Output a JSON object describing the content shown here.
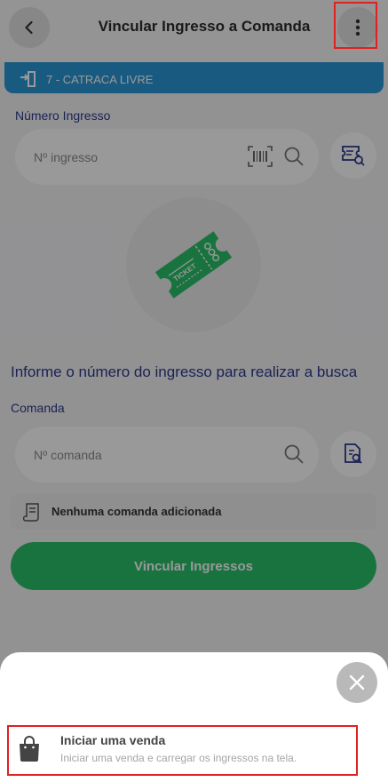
{
  "header": {
    "title": "Vincular Ingresso a Comanda",
    "back_icon": "chevron-left-icon",
    "menu_icon": "more-vertical-icon"
  },
  "gate": {
    "icon": "turnstile-exit-icon",
    "label": "7 - CATRACA LIVRE"
  },
  "ticket_section": {
    "label": "Número Ingresso",
    "placeholder": "Nº ingresso",
    "barcode_icon": "barcode-scan-icon",
    "search_icon": "search-icon",
    "lookup_icon": "ticket-search-icon"
  },
  "illustration": {
    "ticket_text": "TICKET"
  },
  "info_message": "Informe o número do ingresso para realizar a busca",
  "comanda_section": {
    "label": "Comanda",
    "placeholder": "Nº comanda",
    "search_icon": "search-icon",
    "lookup_icon": "document-search-icon",
    "empty_text": "Nenhuma comanda adicionada"
  },
  "primary_button": "Vincular Ingressos",
  "sheet": {
    "close_icon": "close-icon",
    "action_title": "Iniciar uma venda",
    "action_subtitle": "Iniciar uma venda e carregar os ingressos na tela."
  },
  "colors": {
    "accent_green": "#2bc06a",
    "gate_blue": "#2a97d6",
    "label_navy": "#2d3a8c",
    "highlight_red": "#e12020"
  }
}
